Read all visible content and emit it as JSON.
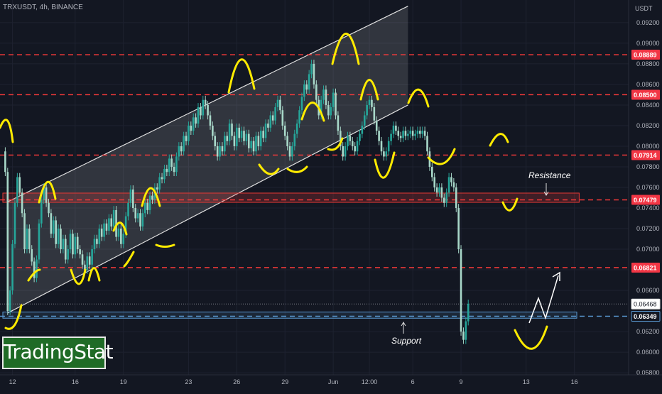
{
  "symbol": "TRXUSDT, 4h, BINANCE",
  "unit": "USDT",
  "watermark": "TradingStat",
  "chart_data": {
    "type": "line",
    "title": "TRXUSDT, 4h, BINANCE",
    "xlabel": "",
    "ylabel": "USDT",
    "ylim": [
      0.0578,
      0.0942
    ],
    "y_ticks": [
      0.058,
      0.06,
      0.062,
      0.066,
      0.068,
      0.07,
      0.072,
      0.074,
      0.076,
      0.078,
      0.08,
      0.082,
      0.084,
      0.086,
      0.088,
      0.09,
      0.092
    ],
    "x_ticks": [
      {
        "label": "12",
        "x": 4
      },
      {
        "label": "16",
        "x": 30
      },
      {
        "label": "19",
        "x": 50
      },
      {
        "label": "23",
        "x": 77
      },
      {
        "label": "26",
        "x": 97
      },
      {
        "label": "29",
        "x": 117
      },
      {
        "label": "Jun",
        "x": 137
      },
      {
        "label": "12:00",
        "x": 152
      },
      {
        "label": "6",
        "x": 170
      },
      {
        "label": "9",
        "x": 190
      },
      {
        "label": "13",
        "x": 217
      },
      {
        "label": "16",
        "x": 237
      }
    ],
    "horizontal_levels": [
      {
        "label": "0.08889",
        "value": 0.08889,
        "color": "#ff3b3b"
      },
      {
        "label": "0.08500",
        "value": 0.085,
        "color": "#ff3b3b"
      },
      {
        "label": "0.07914",
        "value": 0.07914,
        "color": "#ff3b3b"
      },
      {
        "label": "0.07479",
        "value": 0.07479,
        "color": "#ff3b3b"
      },
      {
        "label": "0.06821",
        "value": 0.06821,
        "color": "#ff3b3b"
      },
      {
        "label": "0.06349",
        "value": 0.06349,
        "color": "#5b9bd5"
      }
    ],
    "last_price": {
      "label": "0.06468",
      "value": 0.06468
    },
    "zones": [
      {
        "name": "resistance-zone",
        "y_low": 0.07455,
        "y_high": 0.07545,
        "x_start": 0,
        "x_end": 239,
        "color": "#e53935"
      },
      {
        "name": "support-zone",
        "y_low": 0.0633,
        "y_high": 0.0639,
        "x_start": 0,
        "x_end": 238,
        "color": "#5b9bd5"
      }
    ],
    "channel": {
      "upper": [
        [
          2,
          0.0746
        ],
        [
          168,
          0.0936
        ]
      ],
      "lower": [
        [
          2,
          0.0638
        ],
        [
          168,
          0.084
        ]
      ],
      "end_x": 168
    },
    "series": [
      {
        "points": [
          [
            0,
            0.0795
          ],
          [
            1,
            0.0775
          ],
          [
            2,
            0.064
          ],
          [
            3,
            0.066
          ],
          [
            4,
            0.0705
          ],
          [
            5,
            0.0745
          ],
          [
            6,
            0.077
          ],
          [
            7,
            0.0755
          ],
          [
            8,
            0.0735
          ],
          [
            9,
            0.07
          ],
          [
            10,
            0.072
          ],
          [
            11,
            0.07
          ],
          [
            12,
            0.0688
          ],
          [
            13,
            0.0672
          ],
          [
            14,
            0.069
          ],
          [
            15,
            0.0725
          ],
          [
            16,
            0.0748
          ],
          [
            17,
            0.076
          ],
          [
            18,
            0.0745
          ],
          [
            19,
            0.0735
          ],
          [
            20,
            0.0715
          ],
          [
            21,
            0.0728
          ],
          [
            22,
            0.0705
          ],
          [
            23,
            0.072
          ],
          [
            24,
            0.07
          ],
          [
            25,
            0.071
          ],
          [
            26,
            0.069
          ],
          [
            27,
            0.07
          ],
          [
            28,
            0.0715
          ],
          [
            29,
            0.0695
          ],
          [
            30,
            0.0712
          ],
          [
            31,
            0.07
          ],
          [
            32,
            0.0695
          ],
          [
            33,
            0.0685
          ],
          [
            34,
            0.068
          ],
          [
            35,
            0.0693
          ],
          [
            36,
            0.0685
          ],
          [
            37,
            0.07
          ],
          [
            38,
            0.071
          ],
          [
            39,
            0.0705
          ],
          [
            40,
            0.072
          ],
          [
            41,
            0.0712
          ],
          [
            42,
            0.0725
          ],
          [
            43,
            0.0718
          ],
          [
            44,
            0.073
          ],
          [
            45,
            0.0722
          ],
          [
            46,
            0.0738
          ],
          [
            47,
            0.0712
          ],
          [
            48,
            0.072
          ],
          [
            49,
            0.0705
          ],
          [
            50,
            0.0715
          ],
          [
            51,
            0.0732
          ],
          [
            52,
            0.0745
          ],
          [
            53,
            0.0758
          ],
          [
            54,
            0.074
          ],
          [
            55,
            0.073
          ],
          [
            56,
            0.0735
          ],
          [
            57,
            0.0722
          ],
          [
            58,
            0.0735
          ],
          [
            59,
            0.0745
          ],
          [
            60,
            0.0738
          ],
          [
            61,
            0.0752
          ],
          [
            62,
            0.0748
          ],
          [
            63,
            0.076
          ],
          [
            64,
            0.0758
          ],
          [
            65,
            0.077
          ],
          [
            66,
            0.0768
          ],
          [
            67,
            0.0778
          ],
          [
            68,
            0.0775
          ],
          [
            69,
            0.0788
          ],
          [
            70,
            0.078
          ],
          [
            71,
            0.0775
          ],
          [
            72,
            0.079
          ],
          [
            73,
            0.08
          ],
          [
            74,
            0.0795
          ],
          [
            75,
            0.081
          ],
          [
            76,
            0.0805
          ],
          [
            77,
            0.082
          ],
          [
            78,
            0.0815
          ],
          [
            79,
            0.0828
          ],
          [
            80,
            0.0822
          ],
          [
            81,
            0.0838
          ],
          [
            82,
            0.083
          ],
          [
            83,
            0.0845
          ],
          [
            84,
            0.084
          ],
          [
            85,
            0.083
          ],
          [
            86,
            0.082
          ],
          [
            87,
            0.081
          ],
          [
            88,
            0.08
          ],
          [
            89,
            0.079
          ],
          [
            90,
            0.08
          ],
          [
            91,
            0.0795
          ],
          [
            92,
            0.081
          ],
          [
            93,
            0.0805
          ],
          [
            94,
            0.0822
          ],
          [
            95,
            0.081
          ],
          [
            96,
            0.08
          ],
          [
            97,
            0.0818
          ],
          [
            98,
            0.0808
          ],
          [
            99,
            0.0815
          ],
          [
            100,
            0.0805
          ],
          [
            101,
            0.0812
          ],
          [
            102,
            0.0798
          ],
          [
            103,
            0.0805
          ],
          [
            104,
            0.0795
          ],
          [
            105,
            0.081
          ],
          [
            106,
            0.08
          ],
          [
            107,
            0.0815
          ],
          [
            108,
            0.0808
          ],
          [
            109,
            0.0822
          ],
          [
            110,
            0.0818
          ],
          [
            111,
            0.083
          ],
          [
            112,
            0.0825
          ],
          [
            113,
            0.0838
          ],
          [
            114,
            0.0845
          ],
          [
            115,
            0.0835
          ],
          [
            116,
            0.082
          ],
          [
            117,
            0.081
          ],
          [
            118,
            0.08
          ],
          [
            119,
            0.079
          ],
          [
            120,
            0.08
          ],
          [
            121,
            0.0812
          ],
          [
            122,
            0.0822
          ],
          [
            123,
            0.0835
          ],
          [
            124,
            0.0848
          ],
          [
            125,
            0.086
          ],
          [
            126,
            0.0855
          ],
          [
            127,
            0.087
          ],
          [
            128,
            0.088
          ],
          [
            129,
            0.086
          ],
          [
            130,
            0.0845
          ],
          [
            131,
            0.083
          ],
          [
            132,
            0.0845
          ],
          [
            133,
            0.0855
          ],
          [
            134,
            0.084
          ],
          [
            135,
            0.083
          ],
          [
            136,
            0.0838
          ],
          [
            137,
            0.0852
          ],
          [
            138,
            0.083
          ],
          [
            139,
            0.0815
          ],
          [
            140,
            0.08
          ],
          [
            141,
            0.079
          ],
          [
            142,
            0.08
          ],
          [
            143,
            0.081
          ],
          [
            144,
            0.0805
          ],
          [
            145,
            0.08
          ],
          [
            146,
            0.0795
          ],
          [
            147,
            0.0805
          ],
          [
            148,
            0.0812
          ],
          [
            149,
            0.082
          ],
          [
            150,
            0.083
          ],
          [
            151,
            0.084
          ],
          [
            152,
            0.0845
          ],
          [
            153,
            0.0838
          ],
          [
            154,
            0.0825
          ],
          [
            155,
            0.0815
          ],
          [
            156,
            0.0805
          ],
          [
            157,
            0.0795
          ],
          [
            158,
            0.079
          ],
          [
            159,
            0.0795
          ],
          [
            160,
            0.0805
          ],
          [
            161,
            0.0812
          ],
          [
            162,
            0.082
          ],
          [
            163,
            0.0815
          ],
          [
            164,
            0.081
          ],
          [
            165,
            0.0808
          ],
          [
            166,
            0.0815
          ],
          [
            167,
            0.081
          ],
          [
            168,
            0.0812
          ],
          [
            169,
            0.0815
          ],
          [
            170,
            0.081
          ],
          [
            171,
            0.0812
          ],
          [
            172,
            0.0815
          ],
          [
            173,
            0.0812
          ],
          [
            174,
            0.0815
          ],
          [
            175,
            0.081
          ],
          [
            176,
            0.0795
          ],
          [
            177,
            0.078
          ],
          [
            178,
            0.077
          ],
          [
            179,
            0.076
          ],
          [
            180,
            0.0755
          ],
          [
            181,
            0.076
          ],
          [
            182,
            0.075
          ],
          [
            183,
            0.0745
          ],
          [
            184,
            0.0755
          ],
          [
            185,
            0.077
          ],
          [
            186,
            0.0765
          ],
          [
            187,
            0.076
          ],
          [
            188,
            0.074
          ],
          [
            189,
            0.07
          ],
          [
            190,
            0.062
          ],
          [
            191,
            0.0612
          ],
          [
            192,
            0.063
          ],
          [
            193,
            0.0647
          ]
        ]
      }
    ],
    "annotations": [
      {
        "name": "resistance-label",
        "text": "Resistance"
      },
      {
        "name": "support-label",
        "text": "Support"
      }
    ]
  }
}
